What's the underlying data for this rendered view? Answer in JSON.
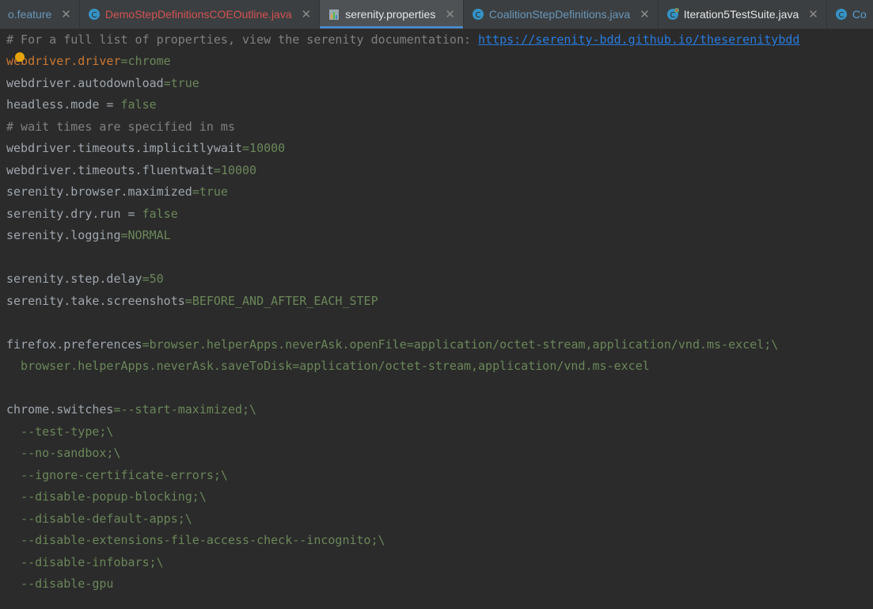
{
  "tabs": [
    {
      "label": "o.feature",
      "color": "#6897bb",
      "icon": "none"
    },
    {
      "label": "DemoStepDefinitionsCOEOutline.java",
      "color": "#d25252",
      "icon": "java-class-icon"
    },
    {
      "label": "serenity.properties",
      "color": "#e6e6e6",
      "icon": "properties-file-icon",
      "active": true
    },
    {
      "label": "CoalitionStepDefinitions.java",
      "color": "#6897bb",
      "icon": "java-class-icon"
    },
    {
      "label": "Iteration5TestSuite.java",
      "color": "#e6e6e6",
      "icon": "java-test-class-icon"
    },
    {
      "label": "Co",
      "color": "#6897bb",
      "icon": "java-class-icon"
    }
  ],
  "editor": {
    "comment1_text": "# For a full list of properties, view the serenity documentation: ",
    "comment1_link": "https://serenity-bdd.github.io/theserenitybdd",
    "l2_key": "webdriver.driver",
    "l2_val": "chrome",
    "l3_key": "webdriver.autodownload",
    "l3_val": "true",
    "l4_key": "headless.mode = ",
    "l4_val": "false",
    "comment2": "# wait times are specified in ms",
    "l6_key": "webdriver.timeouts.implicitlywait",
    "l6_val": "10000",
    "l7_key": "webdriver.timeouts.fluentwait",
    "l7_val": "10000",
    "l8_key": "serenity.browser.maximized",
    "l8_val": "true",
    "l9_key": "serenity.dry.run = ",
    "l9_val": "false",
    "l10_key": "serenity.logging",
    "l10_val": "NORMAL",
    "l12_key": "serenity.step.delay",
    "l12_val": "50",
    "l13_key": "serenity.take.screenshots",
    "l13_val": "BEFORE_AND_AFTER_EACH_STEP",
    "l15_key": "firefox.preferences",
    "l15_val": "browser.helperApps.neverAsk.openFile=application/octet-stream,application/vnd.ms-excel;\\",
    "l16_val": "  browser.helperApps.neverAsk.saveToDisk=application/octet-stream,application/vnd.ms-excel",
    "l18_key": "chrome.switches",
    "l18_val": "--start-maximized;\\",
    "l19": "  --test-type;\\",
    "l20": "  --no-sandbox;\\",
    "l21": "  --ignore-certificate-errors;\\",
    "l22": "  --disable-popup-blocking;\\",
    "l23": "  --disable-default-apps;\\",
    "l24": "  --disable-extensions-file-access-check--incognito;\\",
    "l25": "  --disable-infobars;\\",
    "l26": "  --disable-gpu",
    "eq": "="
  }
}
